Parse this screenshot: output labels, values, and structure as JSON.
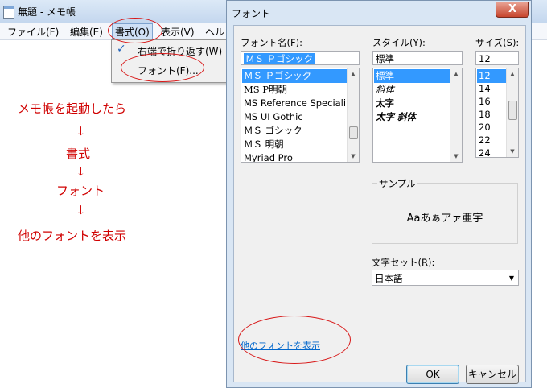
{
  "notepad": {
    "title": "無題 - メモ帳",
    "menu": [
      "ファイル(F)",
      "編集(E)",
      "書式(O)",
      "表示(V)",
      "ヘル"
    ],
    "format_menu": {
      "word_wrap": "右端で折り返す(W)",
      "word_wrap_checked": true,
      "font": "フォント(F)..."
    }
  },
  "annotations": {
    "steps": [
      "メモ帳を起動したら",
      "↓",
      "書式",
      "↓",
      "フォント",
      "↓",
      "他のフォントを表示"
    ],
    "color": "#d00000"
  },
  "font_dialog": {
    "title": "フォント",
    "close_glyph": "X",
    "font_name_label": "フォント名(F):",
    "font_name_value": "ＭＳ Ｐゴシック",
    "font_list": [
      "ＭＳ Ｐゴシック",
      "MS P明朝",
      "MS Reference Speciali",
      "MS UI Gothic",
      "ＭＳ ゴシック",
      "ＭＳ 明朝",
      "Myriad Pro"
    ],
    "style_label": "スタイル(Y):",
    "style_value": "標準",
    "style_list": [
      "標準",
      "斜体",
      "太字",
      "太字 斜体"
    ],
    "size_label": "サイズ(S):",
    "size_value": "12",
    "size_list": [
      "12",
      "14",
      "16",
      "18",
      "20",
      "22",
      "24"
    ],
    "sample_label": "サンプル",
    "sample_text": "Aaあぁアァ亜宇",
    "charset_label": "文字セット(R):",
    "charset_value": "日本語",
    "more_fonts_link": "他のフォントを表示",
    "ok_button": "OK",
    "cancel_button": "キャンセル"
  },
  "colors": {
    "selection": "#3399ff",
    "link": "#0066cc",
    "annotation_red": "#d81818"
  }
}
